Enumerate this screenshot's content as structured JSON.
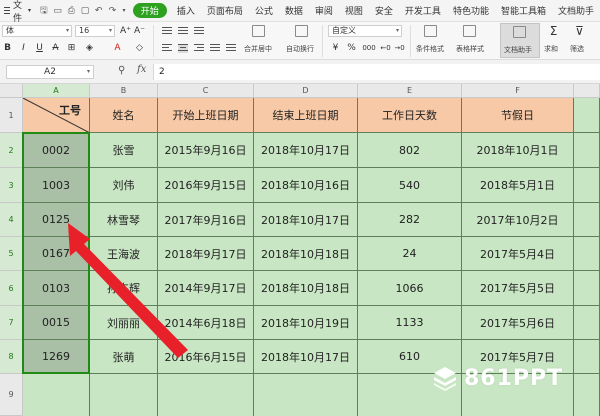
{
  "menu": {
    "file": "文件",
    "tabs": [
      "开始",
      "插入",
      "页面布局",
      "公式",
      "数据",
      "审阅",
      "视图",
      "安全",
      "开发工具",
      "特色功能",
      "智能工具箱",
      "文档助手"
    ],
    "active_tab": "开始"
  },
  "ribbon": {
    "font_name": "体",
    "font_size": "16",
    "number_format": "自定义",
    "merge_label": "合并居中",
    "wrap_label": "自动换行",
    "cond_format_label": "条件格式",
    "table_style_label": "表格样式",
    "doc_helper_label": "文档助手",
    "sum_label": "求和",
    "filter_label": "筛选",
    "bold": "B",
    "italic": "I",
    "underline": "U",
    "font_color": "A",
    "percent": "%",
    "thousands": "000"
  },
  "formula_bar": {
    "name_box": "A2",
    "fx": "fx",
    "value": "2"
  },
  "sheet": {
    "columns": [
      "A",
      "B",
      "C",
      "D",
      "E",
      "F"
    ],
    "row_numbers": [
      "1",
      "2",
      "3",
      "4",
      "5",
      "6",
      "7",
      "8",
      "9"
    ],
    "headers": [
      "工号",
      "姓名",
      "开始上班日期",
      "结束上班日期",
      "工作日天数",
      "节假日"
    ],
    "rows": [
      [
        "0002",
        "张雪",
        "2015年9月16日",
        "2018年10月17日",
        "802",
        "2018年10月1日"
      ],
      [
        "1003",
        "刘伟",
        "2016年9月15日",
        "2018年10月16日",
        "540",
        "2018年5月1日"
      ],
      [
        "0125",
        "林雪琴",
        "2017年9月16日",
        "2018年10月17日",
        "282",
        "2017年10月2日"
      ],
      [
        "0167",
        "王海波",
        "2018年9月17日",
        "2018年10月18日",
        "24",
        "2017年5月4日"
      ],
      [
        "0103",
        "孙杰辉",
        "2014年9月17日",
        "2018年10月18日",
        "1066",
        "2017年5月5日"
      ],
      [
        "0015",
        "刘丽丽",
        "2014年6月18日",
        "2018年10月19日",
        "1133",
        "2017年5月6日"
      ],
      [
        "1269",
        "张萌",
        "2016年6月15日",
        "2018年10月17日",
        "610",
        "2017年5月7日"
      ]
    ],
    "selected_column": "A"
  },
  "watermark": "861PPT",
  "colors": {
    "accent": "#2ea121",
    "header_fill": "#f7c9a6",
    "data_fill": "#c8e6c3",
    "selected_fill": "#a9bfa6",
    "arrow": "#e8202a"
  }
}
